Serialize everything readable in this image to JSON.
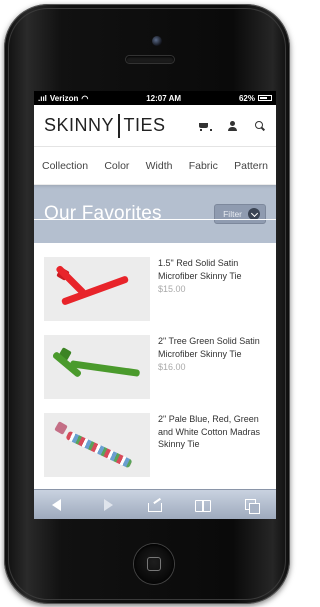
{
  "status_bar": {
    "carrier": "Verizon",
    "time": "12:07 AM",
    "battery": "62%"
  },
  "header": {
    "logo_left": "SKINNY",
    "logo_right": "TIES",
    "icons": [
      "cart-icon",
      "user-icon",
      "search-icon"
    ]
  },
  "nav": {
    "items": [
      "Collection",
      "Color",
      "Width",
      "Fabric",
      "Pattern"
    ]
  },
  "banner": {
    "title": "Our Favorites",
    "filter_label": "Filter"
  },
  "products": [
    {
      "name": "1.5\" Red Solid Satin Microfiber Skinny Tie",
      "price": "$15.00",
      "color": "#e8242a"
    },
    {
      "name": "2\" Tree Green Solid Satin Microfiber Skinny Tie",
      "price": "$16.00",
      "color": "#4a9a2c"
    },
    {
      "name": "2\" Pale Blue, Red, Green and White Cotton Madras Skinny Tie",
      "price": "",
      "color": "#c9a7b6"
    }
  ],
  "toolbar": {
    "buttons": [
      "back-icon",
      "forward-icon",
      "share-icon",
      "bookmarks-icon",
      "tabs-icon"
    ]
  },
  "colors": {
    "banner_bg": "#b4bfcf",
    "toolbar_bg": "#9eaabd"
  }
}
